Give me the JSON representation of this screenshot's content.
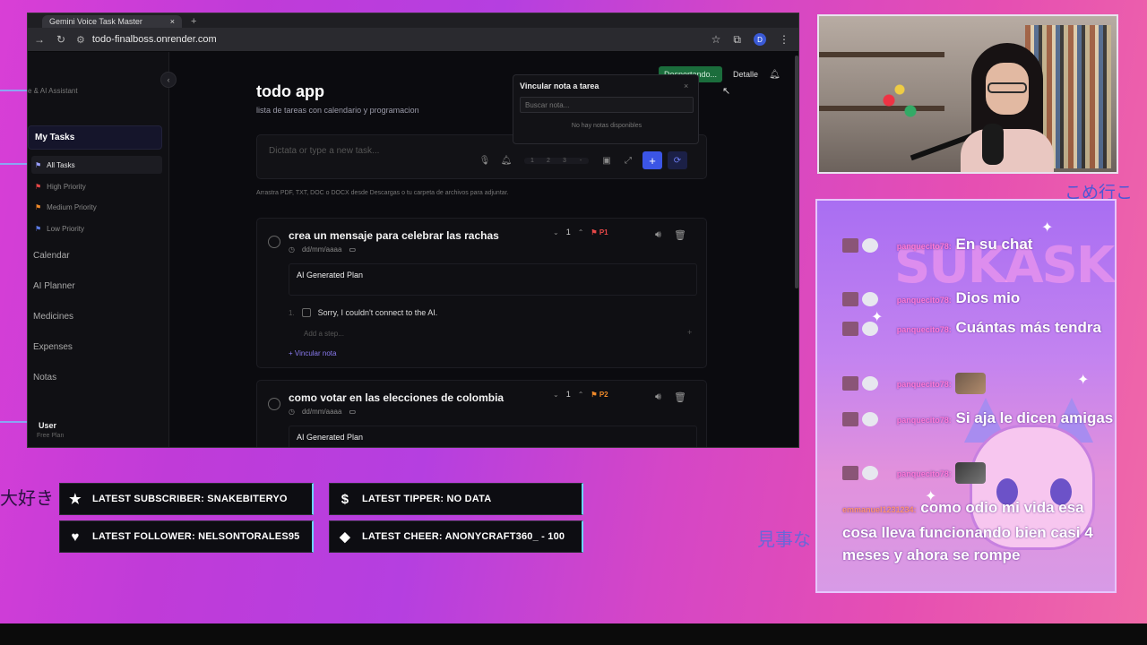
{
  "browser": {
    "tab_title": "Gemini Voice Task Master",
    "tab_close": "×",
    "tab_new": "+",
    "url": "todo-finalboss.onrender.com"
  },
  "sidebar": {
    "subtitle": "e & AI Assistant",
    "my_tasks": "My Tasks",
    "filters": [
      {
        "label": "All Tasks",
        "flag_color": "#9aa0ff"
      },
      {
        "label": "High Priority",
        "flag_color": "#e84848"
      },
      {
        "label": "Medium Priority",
        "flag_color": "#f08a2a"
      },
      {
        "label": "Low Priority",
        "flag_color": "#5b7be6"
      }
    ],
    "items": [
      "Calendar",
      "AI Planner",
      "Medicines",
      "Expenses",
      "Notas"
    ],
    "user_name": "User",
    "user_plan": "Free Plan"
  },
  "header": {
    "status": "Despertando...",
    "detail": "Detalle"
  },
  "popover": {
    "title": "Vincular nota a tarea",
    "close": "×",
    "search_placeholder": "Buscar nota...",
    "empty": "No hay notas disponibles"
  },
  "main": {
    "title": "todo app",
    "subtitle": "lista de tareas con calendario y programacion",
    "composer_placeholder": "Dictata or type a new task...",
    "priority_segments": [
      "1",
      "2",
      "3",
      "-"
    ],
    "hint": "Arrastra PDF, TXT, DOC o DOCX desde Descargas o tu carpeta de archivos para adjuntar."
  },
  "tasks": [
    {
      "title": "crea un mensaje para celebrar las rachas",
      "date_placeholder": "dd/mm/aaaa",
      "count": "1",
      "priority": "P1",
      "plan_title": "AI Generated Plan",
      "step_number": "1.",
      "step_text": "Sorry, I couldn't connect to the AI.",
      "add_step": "Add a step...",
      "link_note": "+ Vincular nota"
    },
    {
      "title": "como votar en las elecciones de colombia",
      "date_placeholder": "dd/mm/aaaa",
      "count": "1",
      "priority": "P2",
      "plan_title": "AI Generated Plan"
    }
  ],
  "chat": {
    "messages": [
      {
        "user": "panquecito78:",
        "text": "En su chat"
      },
      {
        "user": "panquecito78:",
        "text": "Dios mio"
      },
      {
        "user": "panquecito78:",
        "text": "Cuántas más tendra"
      },
      {
        "user": "panquecito78:",
        "text": ""
      },
      {
        "user": "panquecito78:",
        "text": "Si aja le dicen amigas"
      },
      {
        "user": "panquecito78:",
        "text": ""
      },
      {
        "user": "emmanuel1231234:",
        "text": "como odio mi vida esa cosa lleva funcionando bien casi 4 meses y ahora se rompe"
      }
    ]
  },
  "alerts": {
    "subscriber": "LATEST SUBSCRIBER: SNAKEBITERYO",
    "tipper": "LATEST TIPPER: NO DATA",
    "follower": "LATEST FOLLOWER: NELSONTORALES95",
    "cheer": "LATEST CHEER: ANONYCRAFT360_ - 100"
  },
  "overlay_text": {
    "left_jp": "大好き",
    "right_jp": "見事な",
    "top_jp": "こめ行こ"
  }
}
